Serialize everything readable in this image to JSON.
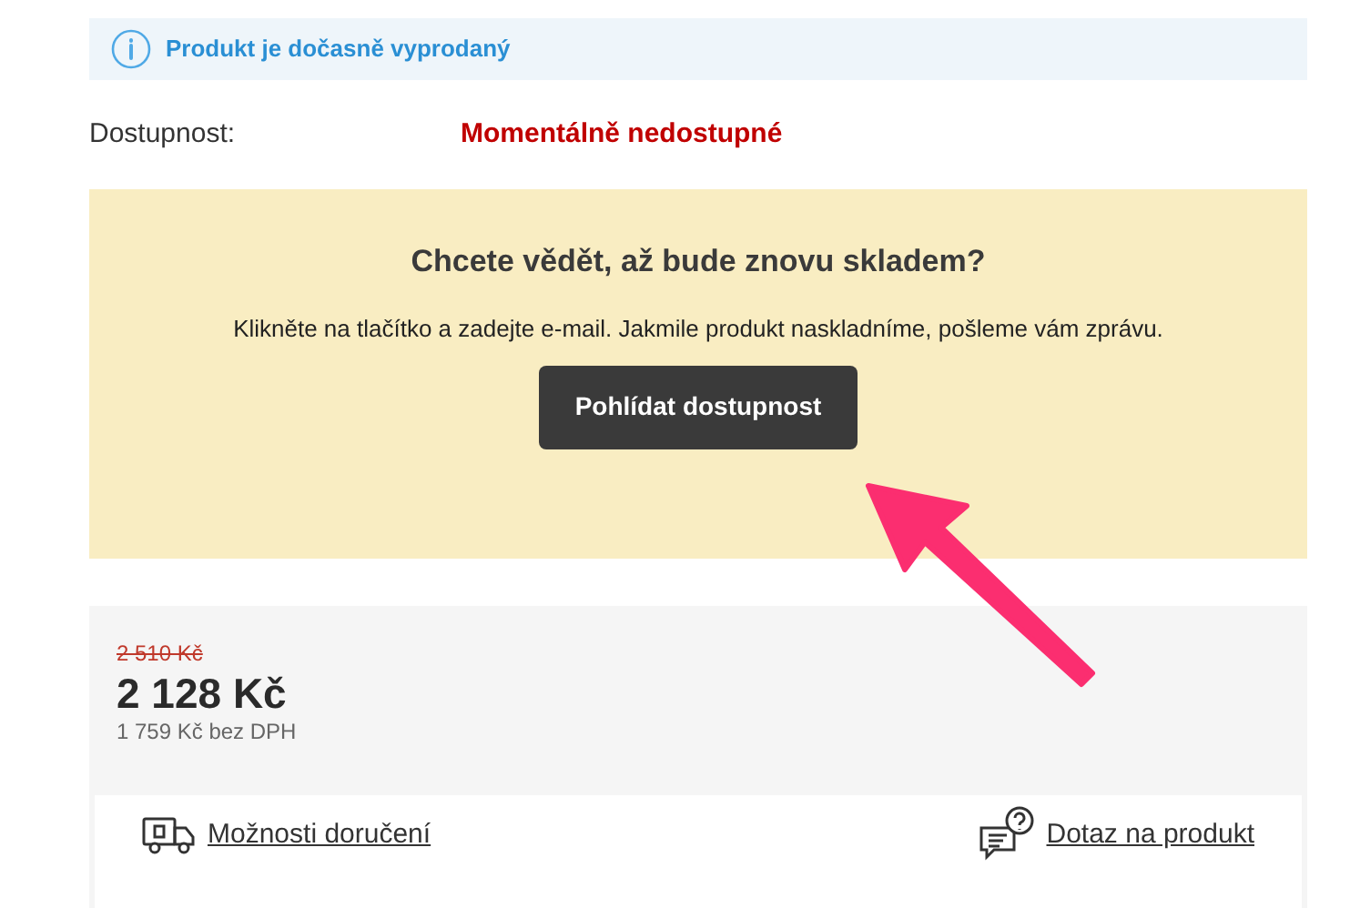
{
  "notice": {
    "text": "Produkt je dočasně vyprodaný"
  },
  "availability": {
    "label": "Dostupnost:",
    "value": "Momentálně nedostupné"
  },
  "restock": {
    "title": "Chcete vědět, až bude znovu skladem?",
    "text": "Klikněte na tlačítko a zadejte e-mail. Jakmile produkt naskladníme, pošleme vám zprávu.",
    "button": "Pohlídat dostupnost"
  },
  "price": {
    "old": "2 510 Kč",
    "current": "2 128 Kč",
    "without_vat": "1 759 Kč bez DPH"
  },
  "links": [
    {
      "kind": "delivery",
      "label": "Možnosti doručení"
    },
    {
      "kind": "question",
      "label": "Dotaz na produkt"
    }
  ]
}
